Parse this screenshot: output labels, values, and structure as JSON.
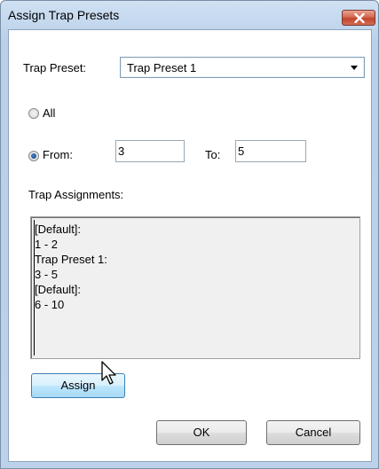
{
  "window": {
    "title": "Assign Trap Presets"
  },
  "trap_preset": {
    "label": "Trap Preset:",
    "selected": "Trap Preset 1"
  },
  "range": {
    "all_label": "All",
    "all_checked": false,
    "from_label": "From:",
    "from_checked": true,
    "from_value": "3",
    "to_label": "To:",
    "to_value": "5"
  },
  "assignments": {
    "label": "Trap Assignments:",
    "lines": [
      "[Default]:",
      "1 - 2",
      "Trap Preset 1:",
      "3 - 5",
      "[Default]:",
      "6 - 10"
    ]
  },
  "buttons": {
    "assign": "Assign",
    "ok": "OK",
    "cancel": "Cancel"
  },
  "icons": {
    "close": "close-icon",
    "dropdown": "chevron-down-icon",
    "cursor": "mouse-pointer-icon"
  }
}
